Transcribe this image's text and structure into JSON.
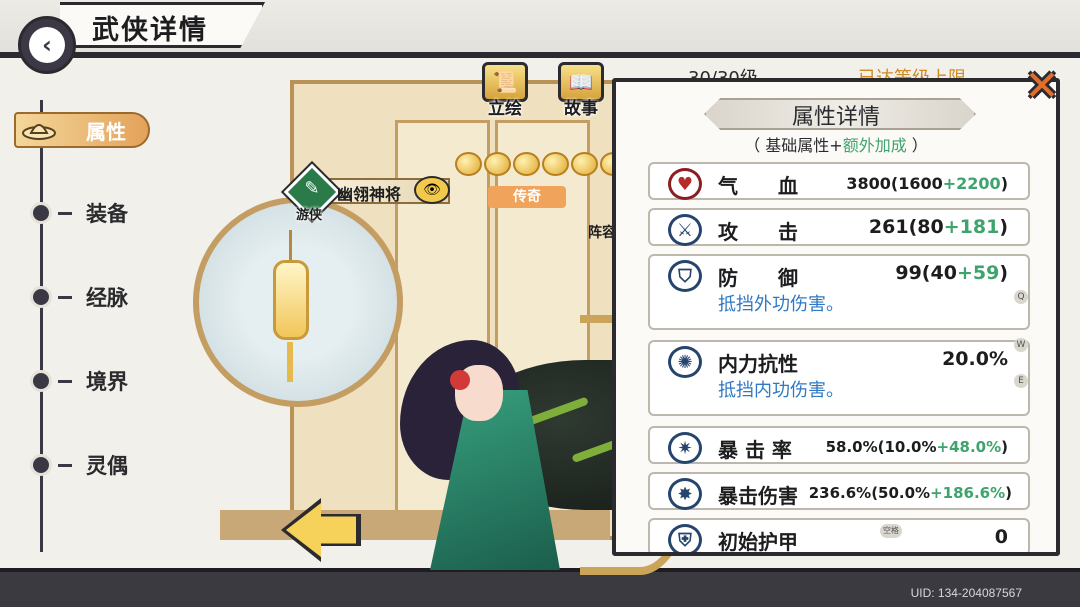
{
  "header": {
    "title": "武侠详情",
    "back_icon": "back-arrow-icon"
  },
  "sidebar": {
    "active": {
      "label": "属性",
      "icon": "hat-icon"
    },
    "items": [
      {
        "label": "装备"
      },
      {
        "label": "经脉"
      },
      {
        "label": "境界"
      },
      {
        "label": "灵偶"
      }
    ]
  },
  "top_tabs": [
    {
      "label": "立绘",
      "icon": "scroll-icon"
    },
    {
      "label": "故事",
      "icon": "book-icon"
    }
  ],
  "level": {
    "text": "30/30级",
    "cap_text": "已达等级上限"
  },
  "hero": {
    "class_label": "游侠",
    "name": "幽翎神将",
    "rarity": "传奇",
    "formation_label": "阵容",
    "stars": 6
  },
  "popup": {
    "title": "属性详情",
    "subtitle_open": "（ 基础属性+",
    "subtitle_green": "额外加成",
    "subtitle_close": " ）",
    "stats": [
      {
        "name": "气　　血",
        "total": "3800(1600",
        "bonus": "+2200",
        "close": ")",
        "icon": "heart-icon"
      },
      {
        "name": "攻　　击",
        "total": "261(80",
        "bonus": "+181",
        "close": ")",
        "icon": "sword-icon"
      },
      {
        "name": "防　　御",
        "total": "99(40",
        "bonus": "+59",
        "close": ")",
        "desc": "抵挡外功伤害。",
        "icon": "shield-icon",
        "hint": "Q"
      },
      {
        "name": "内力抗性",
        "total": "20.0%",
        "desc": "抵挡内功伤害。",
        "icon": "swirl-icon",
        "hint_w": "W",
        "hint_e": "E"
      },
      {
        "name": "暴 击 率",
        "total": "58.0%(10.0%",
        "bonus": "+48.0%",
        "close": ")",
        "icon": "crit-icon"
      },
      {
        "name": "暴击伤害",
        "total": "236.6%(50.0%",
        "bonus": "+186.6%",
        "close": ")",
        "icon": "crit-damage-icon"
      },
      {
        "name": "初始护甲",
        "total": "0",
        "icon": "armor-icon",
        "space_hint": "空格"
      }
    ]
  },
  "footer": {
    "uid": "UID: 134-204087567"
  },
  "colors": {
    "accent": "#e3a25a",
    "bonus_green": "#3ea36c",
    "desc_blue": "#2f78c4"
  }
}
